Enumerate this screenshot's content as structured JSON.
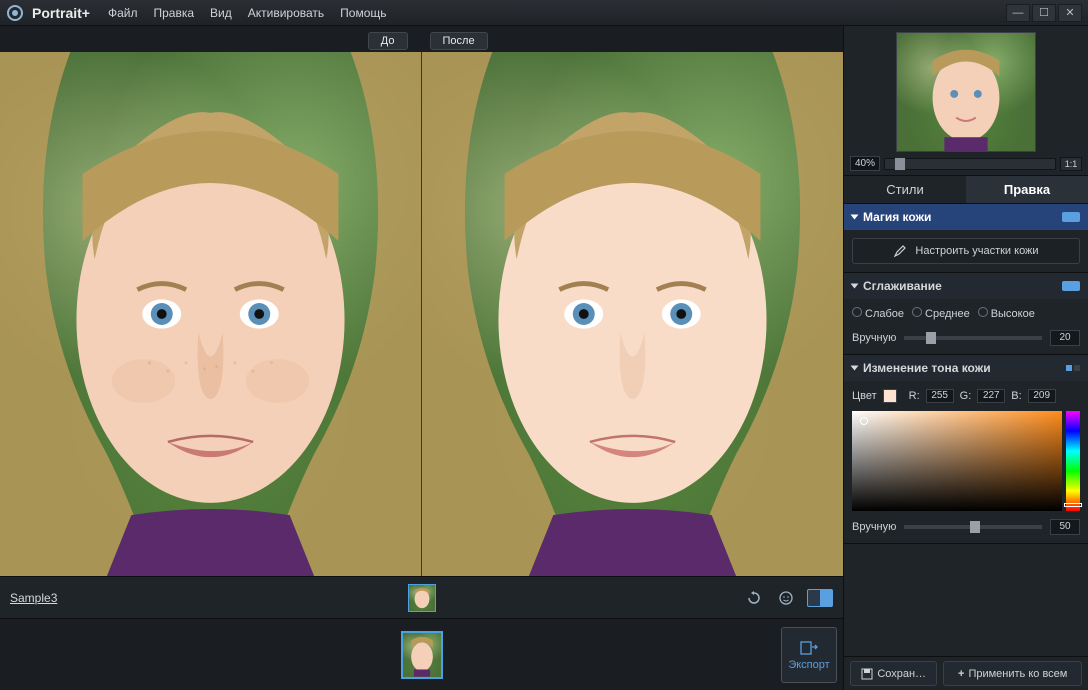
{
  "app": {
    "title": "Portrait+"
  },
  "menu": [
    "Файл",
    "Правка",
    "Вид",
    "Активировать",
    "Помощь"
  ],
  "compare": {
    "before": "До",
    "after": "После"
  },
  "preview": {
    "zoom": "40%",
    "fit_label": "1:1"
  },
  "tabs": {
    "styles": "Стили",
    "edit": "Правка"
  },
  "skin_magic": {
    "title": "Магия кожи",
    "configure_btn": "Настроить участки кожи"
  },
  "smoothing": {
    "title": "Сглаживание",
    "weak": "Слабое",
    "medium": "Среднее",
    "strong": "Высокое",
    "manual_label": "Вручную",
    "manual_value": "20"
  },
  "skin_tone": {
    "title": "Изменение тона кожи",
    "color_label": "Цвет",
    "r_label": "R:",
    "g_label": "G:",
    "b_label": "B:",
    "r": "255",
    "g": "227",
    "b": "209",
    "manual_label": "Вручную",
    "manual_value": "50"
  },
  "bottom": {
    "sample_name": "Sample3",
    "save": "Сохран…",
    "apply_all": "Применить ко всем",
    "export": "Экспорт"
  }
}
